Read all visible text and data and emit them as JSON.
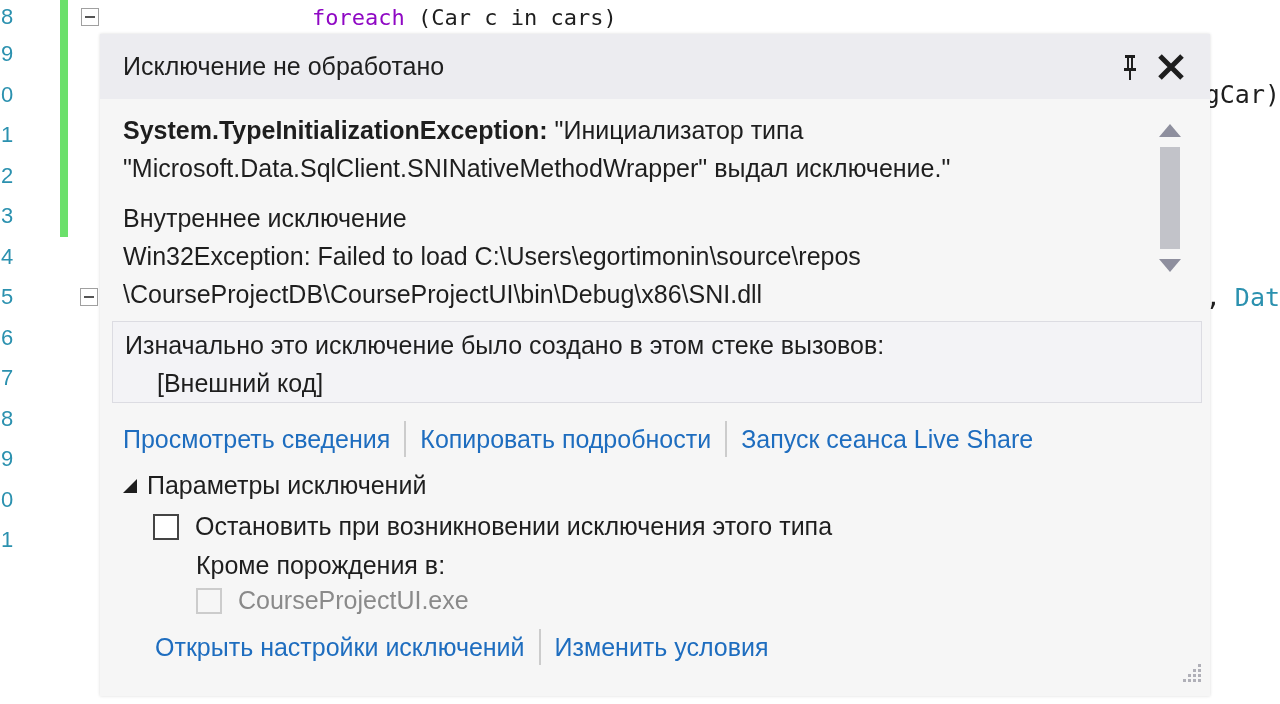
{
  "editor": {
    "lines": [
      {
        "number": "8",
        "code_keyword": "foreach",
        "code": " (Car c in cars)",
        "changed": true,
        "expanded": true
      },
      {
        "number": "9",
        "changed": true
      },
      {
        "number": "0",
        "changed": true,
        "code_right": "gCar)"
      },
      {
        "number": "1",
        "changed": true
      },
      {
        "number": "2",
        "changed": true
      },
      {
        "number": "3",
        "changed": true
      },
      {
        "number": "4"
      },
      {
        "number": "5",
        "expanded": true,
        "code_right": ",",
        "code_right_type": "Dat"
      },
      {
        "number": "6"
      },
      {
        "number": "7"
      },
      {
        "number": "8"
      },
      {
        "number": "9"
      },
      {
        "number": "0"
      },
      {
        "number": "1"
      }
    ]
  },
  "popup": {
    "title": "Исключение не обработано",
    "message": "**System.TypeInitializationException:** \"Инициализатор типа \"Microsoft.Data.SqlClient.SNINativeMethodWrapper\" выдал исключение.\"",
    "inner_heading": "Внутреннее исключение",
    "inner_lines": [
      "Win32Exception: Failed to load C:\\Users\\egortimonin\\source\\repos",
      "\\CourseProjectDB\\CourseProjectUI\\bin\\Debug\\x86\\SNI.dll"
    ],
    "stack": {
      "heading": "Изначально это исключение было создано в этом стеке вызовов:",
      "frames": [
        "[Внешний код]"
      ],
      "expanded": true
    },
    "links": [
      "Просмотреть сведения",
      "Копировать подробности",
      "Запуск сеанса Live Share"
    ],
    "settings": {
      "label": "Параметры исключений",
      "expanded": true,
      "options": [
        {
          "kind": "checkbox",
          "label": "Остановить при возникновении исключения этого типа",
          "checked": false,
          "disabled": false
        },
        {
          "kind": "text",
          "label": "Кроме порождения в:"
        },
        {
          "kind": "checkbox",
          "label": "CourseProjectUI.exe",
          "checked": false,
          "disabled": true
        }
      ]
    },
    "footer_links": [
      "Открыть настройки исключений",
      "Изменить условия"
    ]
  }
}
